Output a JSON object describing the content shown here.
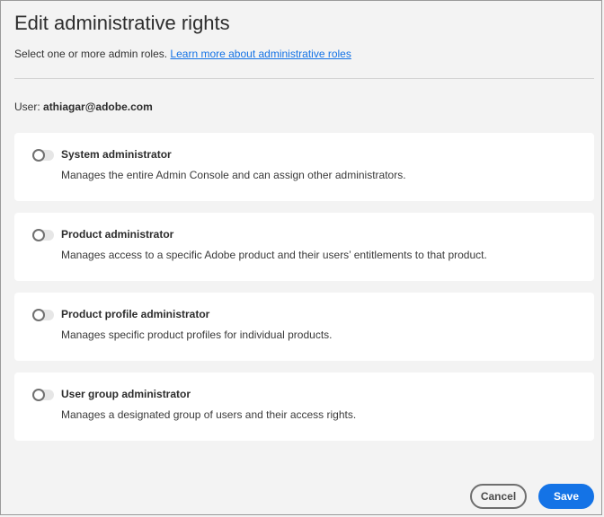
{
  "dialog": {
    "title": "Edit administrative rights",
    "subtitle_text": "Select one or more admin roles. ",
    "subtitle_link": "Learn more about administrative roles",
    "user_label": "User: ",
    "user_email": "athiagar@adobe.com"
  },
  "roles": [
    {
      "title": "System administrator",
      "description": "Manages the entire Admin Console and can assign other administrators.",
      "enabled": false
    },
    {
      "title": "Product administrator",
      "description": "Manages access to a specific Adobe product and their users’ entitlements to that product.",
      "enabled": false
    },
    {
      "title": "Product profile administrator",
      "description": "Manages specific product profiles for individual products.",
      "enabled": false
    },
    {
      "title": "User group administrator",
      "description": "Manages a designated group of users and their access rights.",
      "enabled": false
    }
  ],
  "footer": {
    "cancel_label": "Cancel",
    "save_label": "Save"
  },
  "colors": {
    "accent": "#1473e6",
    "background": "#f3f3f3",
    "card": "#ffffff"
  }
}
